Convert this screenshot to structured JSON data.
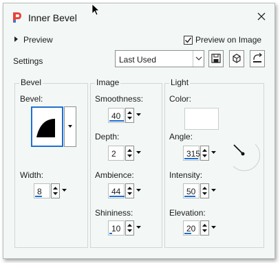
{
  "window": {
    "title": "Inner Bevel"
  },
  "preview": {
    "label": "Preview"
  },
  "preview_on_image": {
    "label": "Preview on Image",
    "checked": true
  },
  "settings": {
    "label": "Settings",
    "preset": "Last Used"
  },
  "bevel_group": {
    "title": "Bevel",
    "bevel_label": "Bevel:",
    "width_label": "Width:",
    "width_value": "8"
  },
  "image_group": {
    "title": "Image",
    "smoothness_label": "Smoothness:",
    "smoothness_value": "40",
    "depth_label": "Depth:",
    "depth_value": "2",
    "ambience_label": "Ambience:",
    "ambience_value": "44",
    "shininess_label": "Shininess:",
    "shininess_value": "10"
  },
  "light_group": {
    "title": "Light",
    "color_label": "Color:",
    "color_value": "#ffffff",
    "angle_label": "Angle:",
    "angle_value": "315",
    "intensity_label": "Intensity:",
    "intensity_value": "50",
    "elevation_label": "Elevation:",
    "elevation_value": "20"
  },
  "icons": {
    "app": "paint-shop-icon",
    "close": "close-icon",
    "save_preset": "save-icon",
    "load_preset": "cube-icon",
    "reset": "reset-icon"
  },
  "colors": {
    "accent": "#1e6fd0",
    "dialog_bg": "#f3f8f6"
  }
}
